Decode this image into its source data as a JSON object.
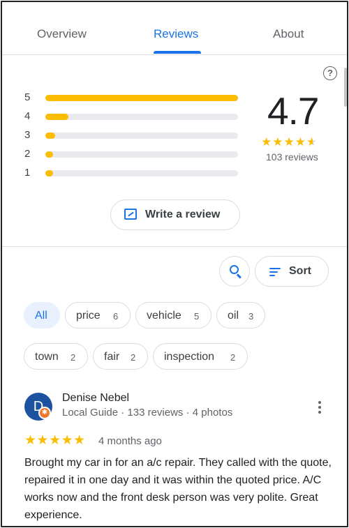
{
  "tabs": [
    {
      "label": "Overview"
    },
    {
      "label": "Reviews",
      "active": true
    },
    {
      "label": "About"
    }
  ],
  "summary": {
    "average": "4.7",
    "average_value": 4.7,
    "count_label": "103 reviews",
    "stars": "★★★★★",
    "histogram": [
      {
        "stars": "5",
        "fraction": 1.0
      },
      {
        "stars": "4",
        "fraction": 0.12
      },
      {
        "stars": "3",
        "fraction": 0.05
      },
      {
        "stars": "2",
        "fraction": 0.04
      },
      {
        "stars": "1",
        "fraction": 0.04
      }
    ]
  },
  "actions": {
    "write_review": "Write a review",
    "sort": "Sort",
    "help_icon": "?"
  },
  "filters": [
    {
      "label": "All",
      "count": "",
      "selected": true
    },
    {
      "label": "price",
      "count": "6"
    },
    {
      "label": "vehicle",
      "count": "5"
    },
    {
      "label": "oil",
      "count": "3"
    },
    {
      "label": "town",
      "count": "2"
    },
    {
      "label": "fair",
      "count": "2"
    },
    {
      "label": "inspection",
      "count": "2"
    }
  ],
  "review": {
    "avatar_initial": "D",
    "badge": "✱",
    "name": "Denise Nebel",
    "meta": "Local Guide · 133 reviews · 4 photos",
    "stars": "★★★★★",
    "rating": 5,
    "age": "4 months ago",
    "text": "Brought my car in for an a/c repair. They called with the quote, repaired it in one day and it was within the quoted price. A/C works now and the front desk person was very polite. Great experience."
  },
  "colors": {
    "accent": "#1a73e8",
    "star": "#fbbc04",
    "track": "#e8eaed",
    "avatar": "#1c52a0",
    "badge": "#f0782b"
  }
}
